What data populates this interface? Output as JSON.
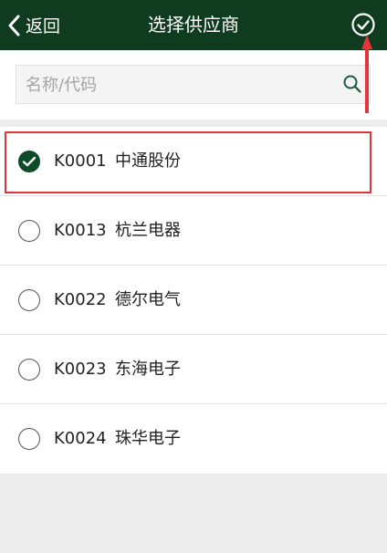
{
  "header": {
    "back_label": "返回",
    "title": "选择供应商",
    "bg_color": "#0f3b1f"
  },
  "search": {
    "placeholder": "名称/代码",
    "value": ""
  },
  "suppliers": [
    {
      "code": "K0001",
      "name": "中通股份",
      "selected": true
    },
    {
      "code": "K0013",
      "name": "杭兰电器",
      "selected": false
    },
    {
      "code": "K0022",
      "name": "德尔电气",
      "selected": false
    },
    {
      "code": "K0023",
      "name": "东海电子",
      "selected": false
    },
    {
      "code": "K0024",
      "name": "珠华电子",
      "selected": false
    }
  ],
  "annotation": {
    "color": "#e0353b"
  }
}
